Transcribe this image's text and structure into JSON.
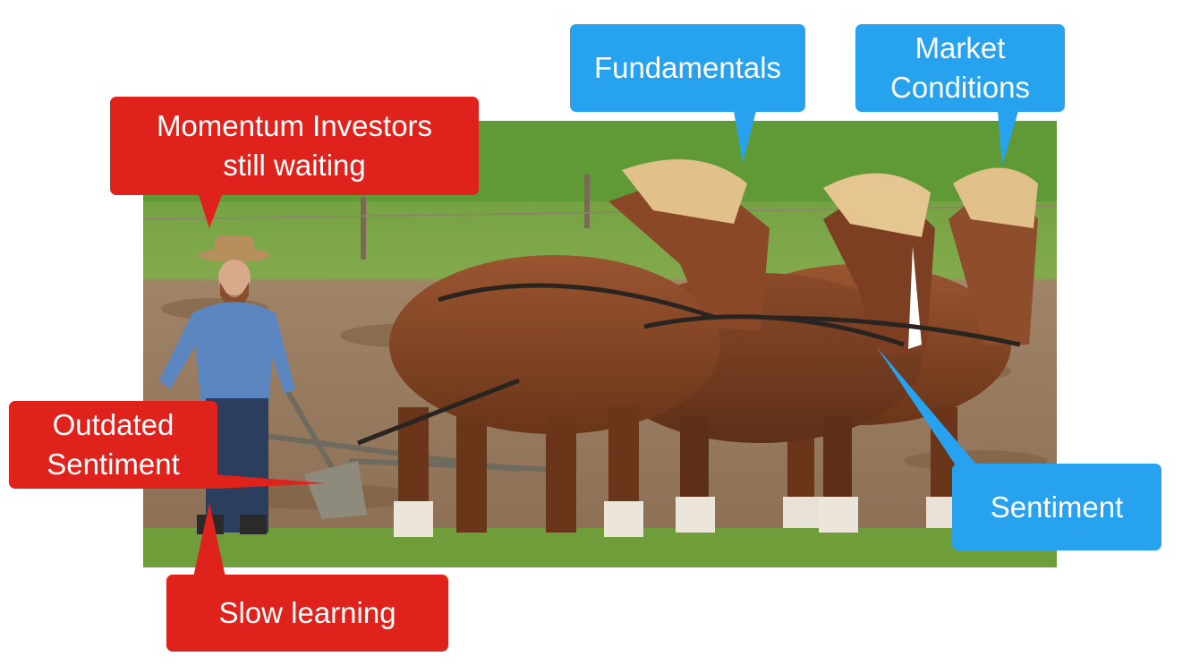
{
  "image": {
    "subject": "farm-scene-photo",
    "colors": {
      "red_callout": "#e0221c",
      "blue_callout": "#27a2ef",
      "text": "#ffffff"
    }
  },
  "callouts": {
    "momentum": {
      "text": "Momentum Investors\nstill waiting",
      "color": "red"
    },
    "fundamentals": {
      "text": "Fundamentals",
      "color": "blue"
    },
    "market": {
      "text": "Market\nConditions",
      "color": "blue"
    },
    "outdated": {
      "text": "Outdated\nSentiment",
      "color": "red"
    },
    "sentiment": {
      "text": "Sentiment",
      "color": "blue"
    },
    "slow": {
      "text": "Slow learning",
      "color": "red"
    }
  }
}
